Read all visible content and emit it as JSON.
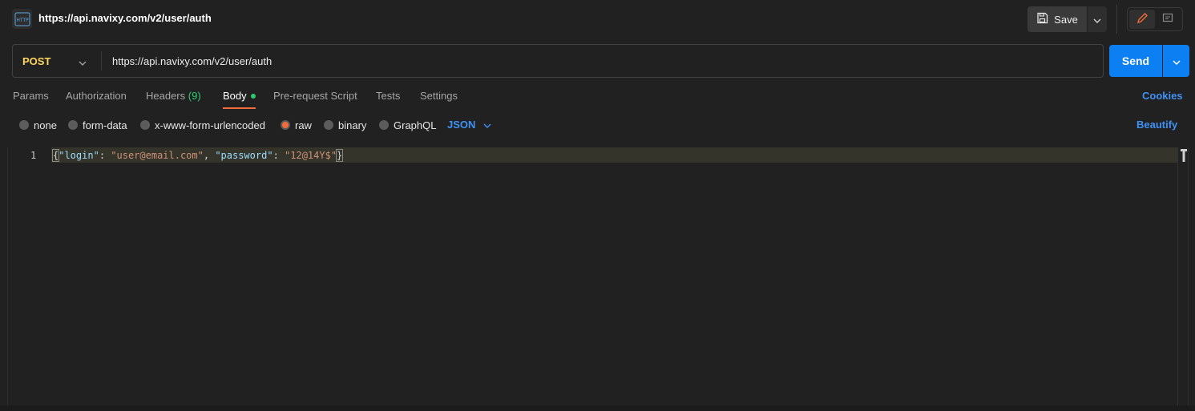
{
  "header": {
    "icon_label": "HTTP",
    "title": "https://api.navixy.com/v2/user/auth",
    "save_label": "Save"
  },
  "request": {
    "method": "POST",
    "url": "https://api.navixy.com/v2/user/auth",
    "send_label": "Send"
  },
  "tabs": {
    "params": "Params",
    "authorization": "Authorization",
    "headers": "Headers",
    "headers_count": "(9)",
    "body": "Body",
    "pre_request": "Pre-request Script",
    "tests": "Tests",
    "settings": "Settings",
    "cookies": "Cookies"
  },
  "body_types": {
    "none": "none",
    "form_data": "form-data",
    "urlencoded": "x-www-form-urlencoded",
    "raw": "raw",
    "binary": "binary",
    "graphql": "GraphQL",
    "selected": "raw",
    "language": "JSON",
    "beautify": "Beautify"
  },
  "editor": {
    "line_number": "1",
    "open_brace": "{",
    "key1": "\"login\"",
    "sep1": ": ",
    "val1": "\"user@email.com\"",
    "comma": ", ",
    "key2": "\"password\"",
    "sep2": ": ",
    "val2": "\"12@14Y$\"",
    "close_brace": "}"
  },
  "colors": {
    "accent": "#f26b3a",
    "send_blue": "#0c7ff2",
    "link_blue": "#3e92f5",
    "method_yellow": "#ffd75e",
    "status_green": "#2ecc71"
  }
}
